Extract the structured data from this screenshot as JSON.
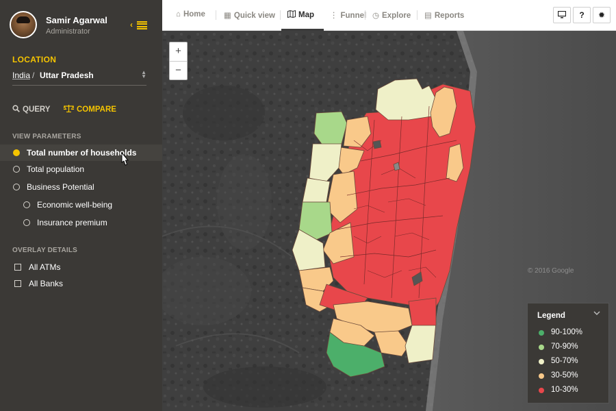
{
  "profile": {
    "name": "Samir Agarwal",
    "role": "Administrator"
  },
  "location": {
    "title": "LOCATION",
    "country": "India",
    "separator": "/",
    "state": "Uttar Pradesh"
  },
  "modes": {
    "query": "QUERY",
    "compare": "COMPARE"
  },
  "view_parameters": {
    "title": "VIEW PARAMETERS",
    "items": [
      {
        "label": "Total number of households",
        "active": true
      },
      {
        "label": "Total population"
      },
      {
        "label": "Business Potential"
      },
      {
        "label": "Economic well-being"
      },
      {
        "label": "Insurance premium"
      }
    ]
  },
  "overlay": {
    "title": "OVERLAY DETAILS",
    "items": [
      {
        "label": "All ATMs"
      },
      {
        "label": "All Banks"
      }
    ]
  },
  "nav": {
    "items": [
      {
        "label": "Home",
        "icon": "home-icon"
      },
      {
        "label": "Quick view",
        "icon": "grid-icon"
      },
      {
        "label": "Map",
        "icon": "map-icon",
        "active": true
      },
      {
        "label": "Funnel",
        "icon": "funnel-icon"
      },
      {
        "label": "Explore",
        "icon": "compass-icon"
      },
      {
        "label": "Reports",
        "icon": "document-icon"
      }
    ]
  },
  "toolbar": {
    "help": "?"
  },
  "map": {
    "zoom_in": "+",
    "zoom_out": "−",
    "watermark": "© 2016 Google"
  },
  "legend": {
    "title": "Legend",
    "items": [
      {
        "label": "90-100%",
        "color": "#4caf6a"
      },
      {
        "label": "70-90%",
        "color": "#a8d88a"
      },
      {
        "label": "50-70%",
        "color": "#eff0c8"
      },
      {
        "label": "30-50%",
        "color": "#f9c98a"
      },
      {
        "label": "10-30%",
        "color": "#e8474b"
      }
    ]
  },
  "colors": {
    "accent": "#f5c400",
    "sidebar": "#3b3936"
  }
}
